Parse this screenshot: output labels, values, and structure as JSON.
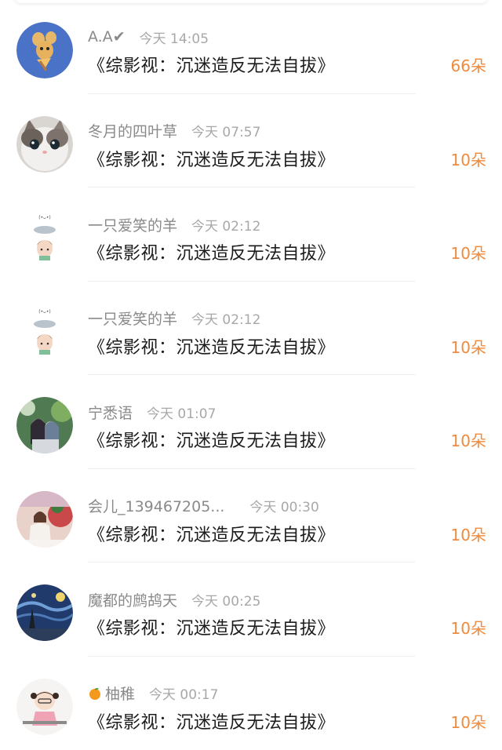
{
  "colors": {
    "username": "#8a8a8a",
    "time": "#a8a8a8",
    "title": "#1c1c1c",
    "amount": "#f08a3c",
    "divider": "#f0f0f0"
  },
  "rows": [
    {
      "username": "A.A✔",
      "time": "今天 14:05",
      "title": "《综影视：沉迷造反无法自拔》",
      "amount": "66朵",
      "avatar_icon": "cartoon-mouse-avatar-icon"
    },
    {
      "username": "冬月的四叶草",
      "time": "今天 07:57",
      "title": "《综影视：沉迷造反无法自拔》",
      "amount": "10朵",
      "avatar_icon": "kitten-avatar-icon"
    },
    {
      "username": "一只爱笑的羊",
      "time": "今天 02:12",
      "title": "《综影视：沉迷造反无法自拔》",
      "amount": "10朵",
      "avatar_icon": "chibi-avatar-icon"
    },
    {
      "username": "一只爱笑的羊",
      "time": "今天 02:12",
      "title": "《综影视：沉迷造反无法自拔》",
      "amount": "10朵",
      "avatar_icon": "chibi-avatar-icon"
    },
    {
      "username": "宁悉语",
      "time": "今天 01:07",
      "title": "《综影视：沉迷造反无法自拔》",
      "amount": "10朵",
      "avatar_icon": "anime-couple-avatar-icon"
    },
    {
      "username": "会儿_139467205...",
      "time": "今天 00:30",
      "title": "《综影视：沉迷造反无法自拔》",
      "amount": "10朵",
      "avatar_icon": "painting-girl-avatar-icon"
    },
    {
      "username": "魔都的鹧鸪天",
      "time": "今天 00:25",
      "title": "《综影视：沉迷造反无法自拔》",
      "amount": "10朵",
      "avatar_icon": "starry-night-avatar-icon"
    },
    {
      "username": "柚稚",
      "username_prefix_icon": "orange-fruit-icon",
      "time": "今天 00:17",
      "title": "《综影视：沉迷造反无法自拔》",
      "amount": "10朵",
      "avatar_icon": "cartoon-girl-avatar-icon"
    }
  ]
}
